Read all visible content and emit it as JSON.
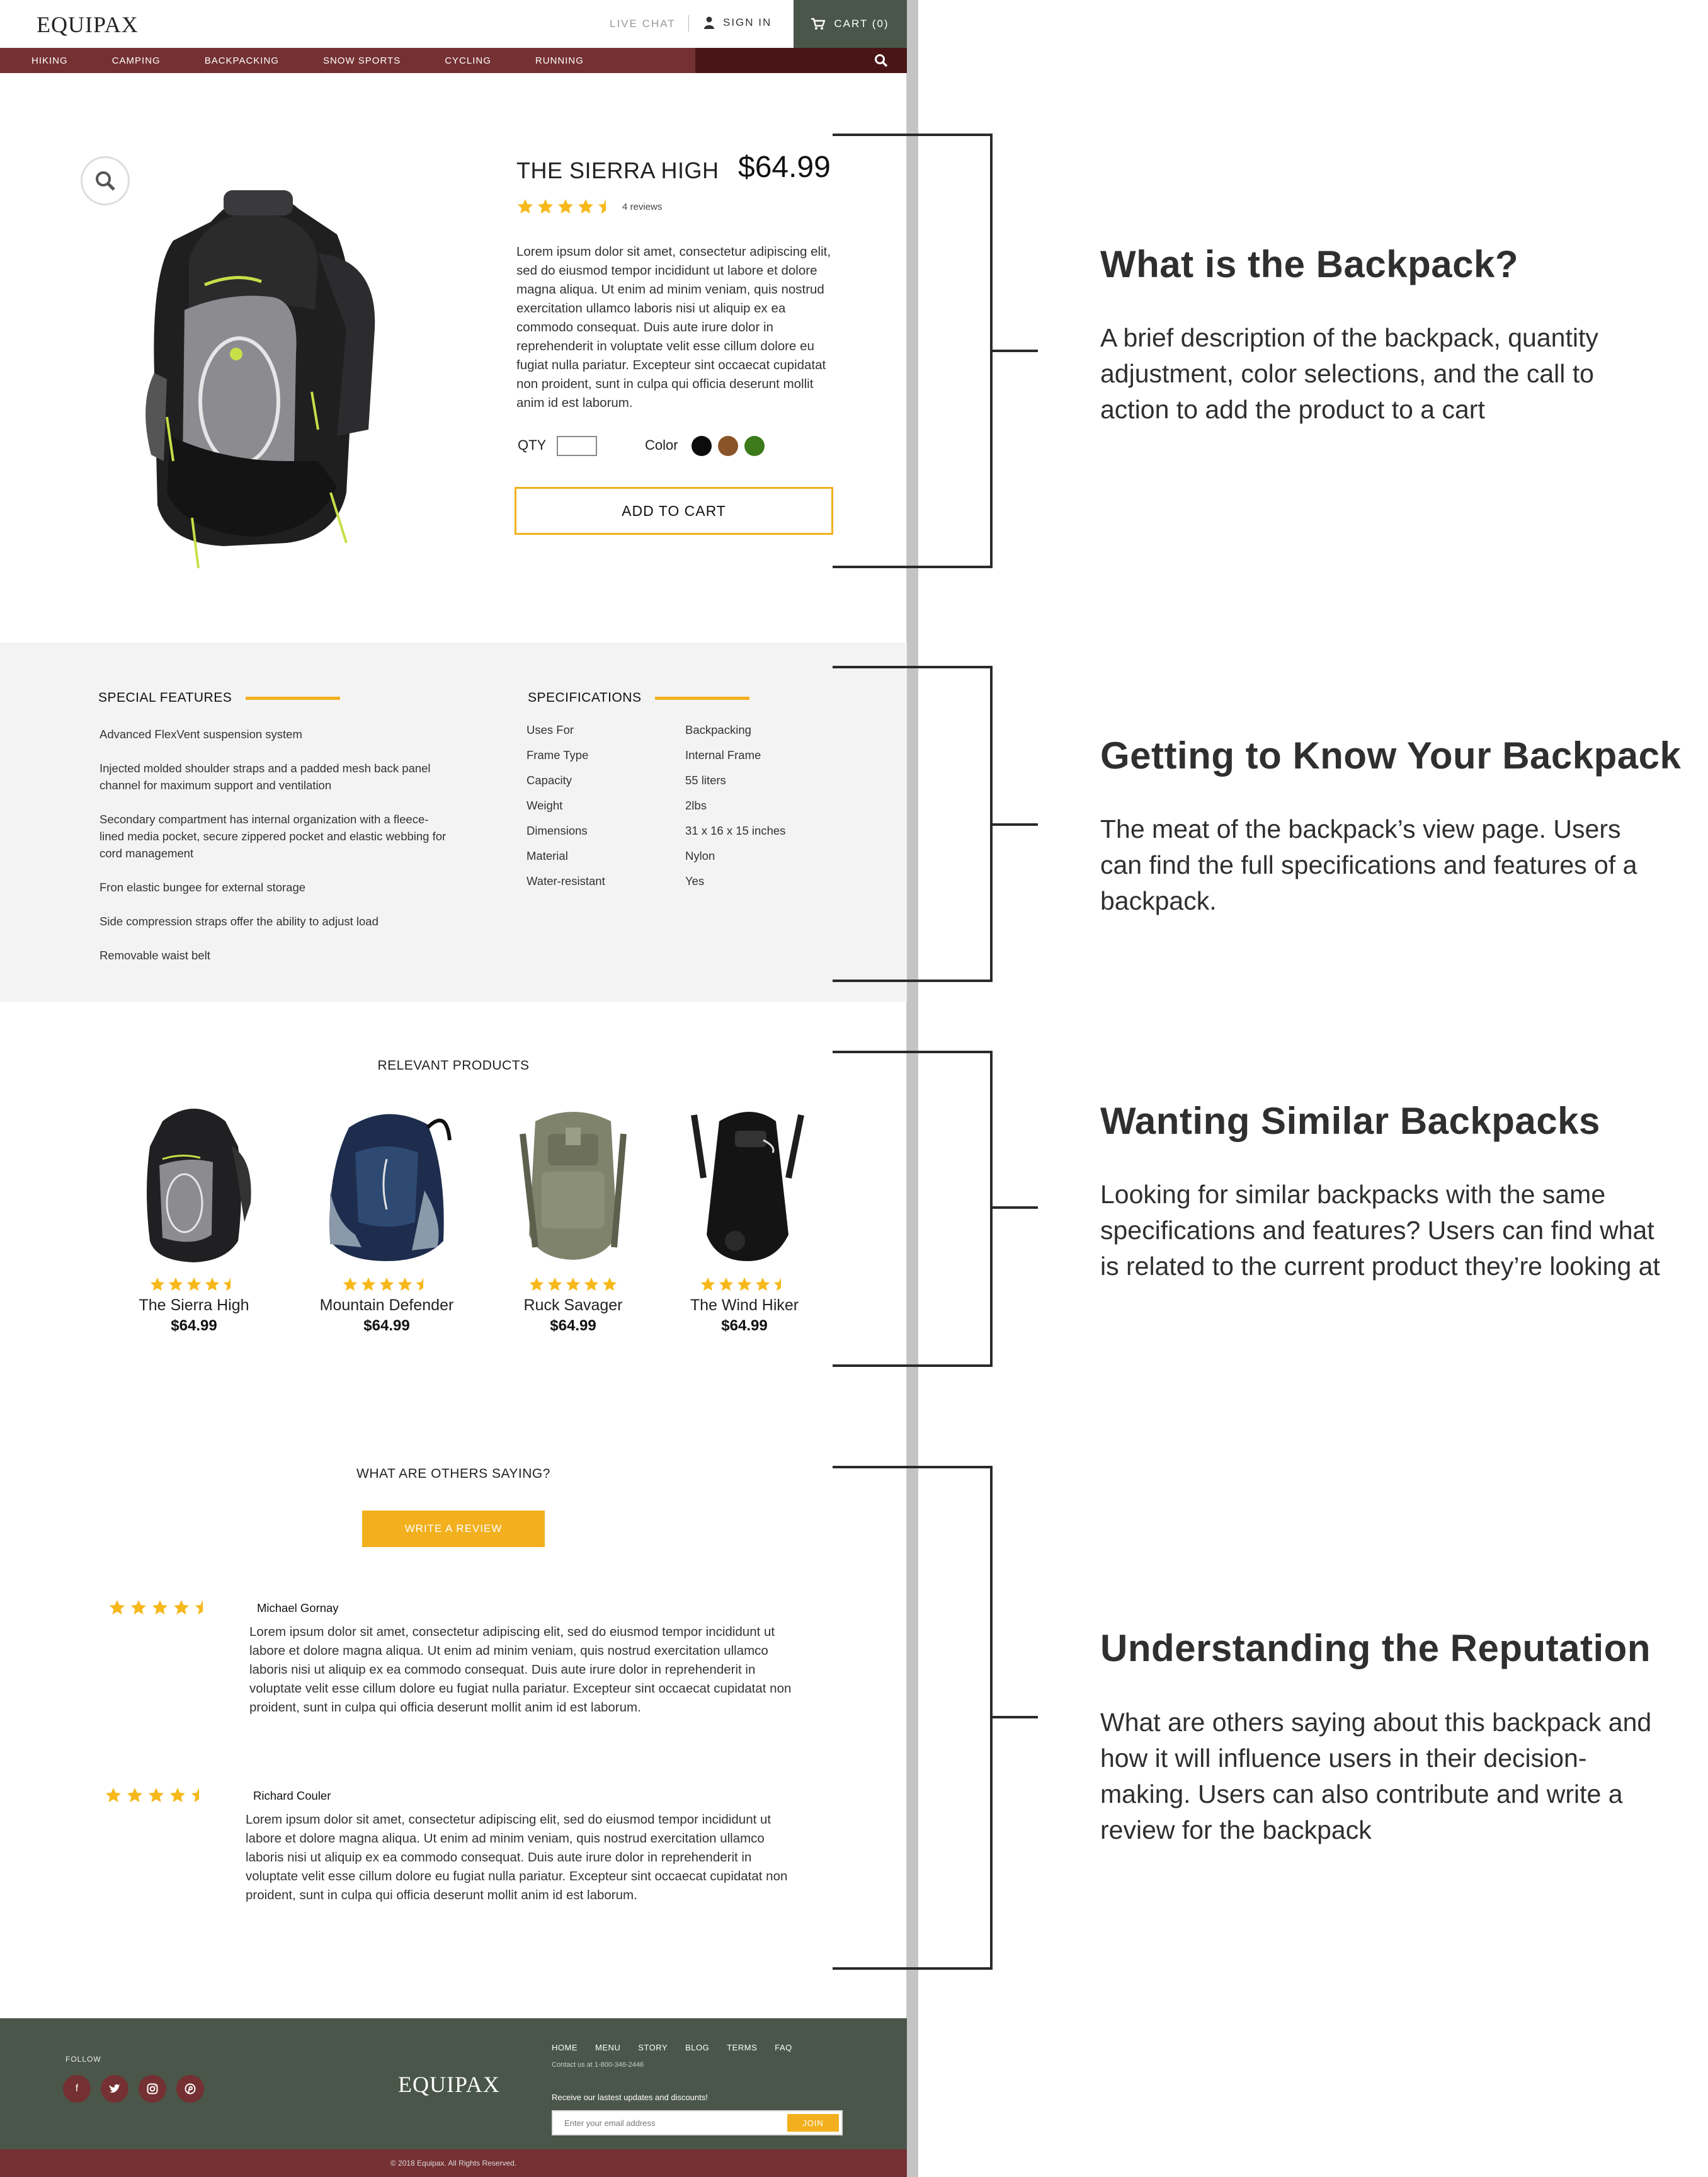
{
  "header": {
    "logo": "E̸UIPAX",
    "logo_text": "EQUIPAX",
    "live_chat": "LIVE CHAT",
    "sign_in": "SIGN IN",
    "cart": "CART (0)"
  },
  "nav": {
    "items": [
      "HIKING",
      "CAMPING",
      "BACKPACKING",
      "SNOW SPORTS",
      "CYCLING",
      "RUNNING"
    ]
  },
  "product": {
    "title": "THE SIERRA HIGH",
    "price": "$64.99",
    "rating": 4.5,
    "reviews": "4 reviews",
    "description": "Lorem ipsum dolor sit amet, consectetur adipiscing elit, sed do eiusmod tempor incididunt ut labore et dolore magna aliqua. Ut enim ad minim veniam, quis nostrud exercitation ullamco laboris nisi ut aliquip ex ea commodo consequat. Duis aute irure dolor in reprehenderit in voluptate velit esse cillum dolore eu fugiat nulla pariatur. Excepteur sint occaecat cupidatat non proident, sunt in culpa qui officia deserunt mollit anim id est laborum.",
    "qty_label": "QTY",
    "color_label": "Color",
    "colors": [
      "#0c0c0c",
      "#8a5428",
      "#3c7a1a"
    ],
    "add_to_cart": "ADD TO CART"
  },
  "features": {
    "heading": "SPECIAL FEATURES",
    "items": [
      "Advanced FlexVent suspension system",
      "Injected molded shoulder straps and a padded mesh back panel channel for maximum support and ventilation",
      "Secondary compartment has internal organization with a fleece-lined media pocket, secure zippered pocket and elastic webbing for cord management",
      "Fron elastic bungee for external storage",
      "Side compression straps offer the ability to adjust load",
      "Removable waist belt"
    ]
  },
  "specs": {
    "heading": "SPECIFICATIONS",
    "rows": [
      [
        "Uses For",
        "Backpacking"
      ],
      [
        "Frame Type",
        "Internal Frame"
      ],
      [
        "Capacity",
        "55 liters"
      ],
      [
        "Weight",
        "2lbs"
      ],
      [
        "Dimensions",
        "31 x 16 x 15 inches"
      ],
      [
        "Material",
        "Nylon"
      ],
      [
        "Water-resistant",
        "Yes"
      ]
    ]
  },
  "relevant": {
    "heading": "RELEVANT PRODUCTS",
    "items": [
      {
        "name": "The Sierra High",
        "price": "$64.99",
        "rating": 4.5
      },
      {
        "name": "Mountain Defender",
        "price": "$64.99",
        "rating": 4.5
      },
      {
        "name": "Ruck Savager",
        "price": "$64.99",
        "rating": 5
      },
      {
        "name": "The Wind Hiker",
        "price": "$64.99",
        "rating": 4.5
      }
    ]
  },
  "reviews": {
    "heading": "WHAT ARE OTHERS SAYING?",
    "write_button": "WRITE A REVIEW",
    "items": [
      {
        "name": "Michael Gornay",
        "rating": 4.5,
        "text": "Lorem ipsum dolor sit amet, consectetur adipiscing elit, sed do eiusmod tempor incididunt ut labore et dolore magna aliqua. Ut enim ad minim veniam, quis nostrud exercitation ullamco laboris nisi ut aliquip ex ea commodo consequat. Duis aute irure dolor in reprehenderit in voluptate velit esse cillum dolore eu fugiat nulla pariatur. Excepteur sint occaecat cupidatat non proident, sunt in culpa qui officia deserunt mollit anim id est laborum."
      },
      {
        "name": "Richard Couler",
        "rating": 4.5,
        "text": "Lorem ipsum dolor sit amet, consectetur adipiscing elit, sed do eiusmod tempor incididunt ut labore et dolore magna aliqua. Ut enim ad minim veniam, quis nostrud exercitation ullamco laboris nisi ut aliquip ex ea commodo consequat. Duis aute irure dolor in reprehenderit in voluptate velit esse cillum dolore eu fugiat nulla pariatur. Excepteur sint occaecat cupidatat non proident, sunt in culpa qui officia deserunt mollit anim id est laborum."
      }
    ]
  },
  "footer": {
    "follow": "FOLLOW",
    "socials": [
      "facebook-icon",
      "twitter-icon",
      "instagram-icon",
      "pinterest-icon"
    ],
    "logo": "EQUIPAX",
    "nav": [
      "HOME",
      "MENU",
      "STORY",
      "BLOG",
      "TERMS",
      "FAQ"
    ],
    "contact": "Contact us at 1-800-346-2446",
    "newsletter": "Receive our lastest updates and discounts!",
    "email_placeholder": "Enter your email address",
    "join": "JOIN",
    "copyright": "© 2018 Equipax. All Rights Reserved."
  },
  "annotations": [
    {
      "title": "What is the Backpack?",
      "body": "A brief description of the backpack, quantity adjustment, color selections, and the call to action to add the product to a cart"
    },
    {
      "title": "Getting to Know Your Backpack",
      "body": "The meat of the backpack’s view page. Users can find the full specifications and features of a backpack."
    },
    {
      "title": "Wanting Similar Backpacks",
      "body": "Looking for similar backpacks with the same specifications and features? Users can find what is related to the current product they’re looking at"
    },
    {
      "title": "Understanding the Reputation",
      "body": "What are others saying about this backpack and how it will influence users in their decision-making. Users can also contribute and write a review for the backpack"
    }
  ],
  "colors": {
    "nav": "#743032",
    "nav_dark": "#4a1517",
    "cart": "#4a5649",
    "footer": "#4a5649",
    "accent": "#f2b01e",
    "star": "#f6b81a"
  }
}
